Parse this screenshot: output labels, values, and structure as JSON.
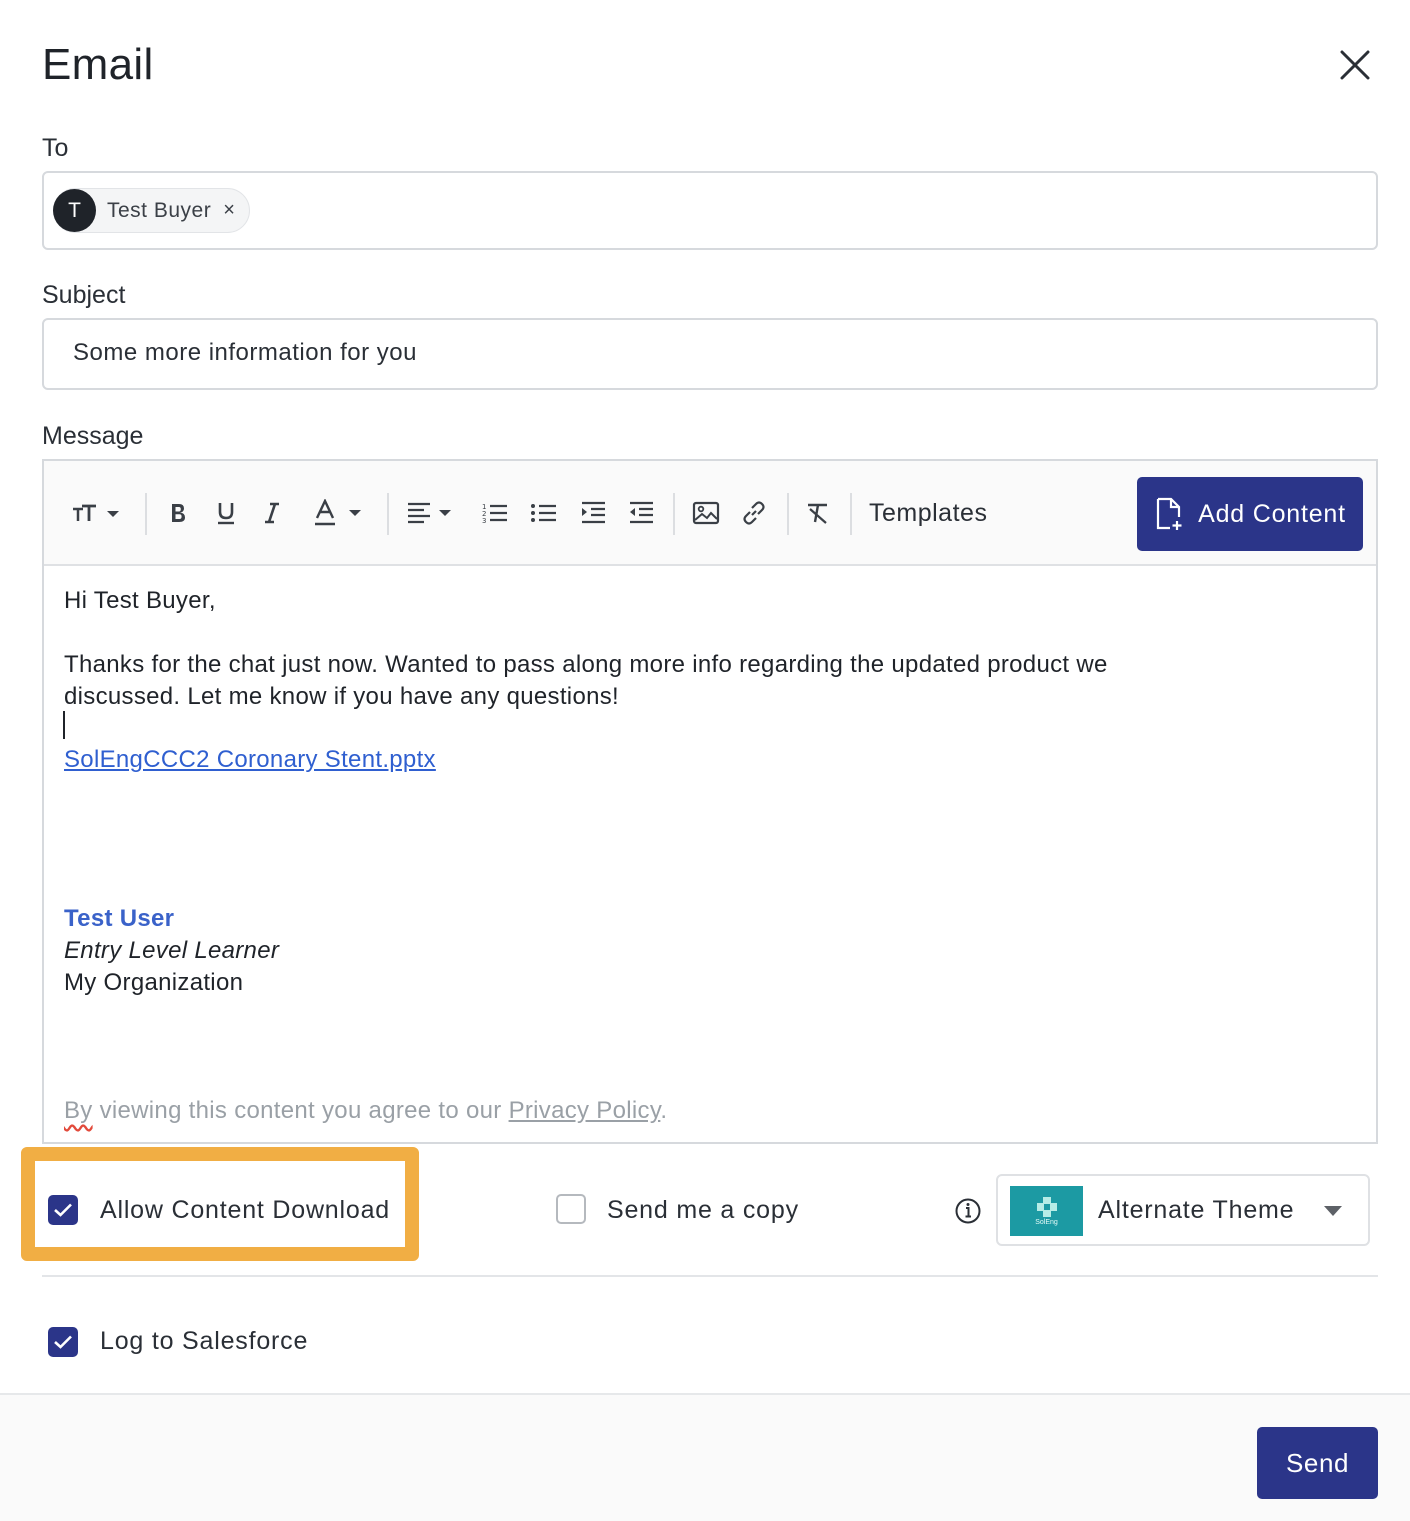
{
  "dialog": {
    "title": "Email",
    "close_icon": "close-icon"
  },
  "to": {
    "label": "To",
    "recipients": [
      {
        "initial": "T",
        "name": "Test Buyer",
        "remove_glyph": "×"
      }
    ]
  },
  "subject": {
    "label": "Subject",
    "value": "Some more information for you"
  },
  "message": {
    "label": "Message",
    "toolbar": {
      "templates_label": "Templates",
      "add_content_label": "Add Content",
      "icons": [
        "font-size-icon",
        "bold-icon",
        "underline-icon",
        "italic-icon",
        "text-color-icon",
        "align-icon",
        "ordered-list-icon",
        "bullet-list-icon",
        "indent-icon",
        "outdent-icon",
        "image-icon",
        "link-icon",
        "clear-format-icon",
        "add-file-icon"
      ]
    },
    "body": {
      "greeting": "Hi Test Buyer,",
      "line1": "Thanks for the chat just now. Wanted to pass along more info regarding the updated product we",
      "line2": "discussed. Let me know if you have any questions!",
      "attachment_link": "SolEngCCC2 Coronary Stent.pptx",
      "signature_name": "Test User",
      "signature_title": "Entry Level Learner",
      "signature_org": "My Organization",
      "privacy_by": "By",
      "privacy_mid": " viewing this content you agree to our ",
      "privacy_link": "Privacy Policy",
      "privacy_end": "."
    }
  },
  "options": {
    "allow_download": {
      "label": "Allow Content Download",
      "checked": true
    },
    "send_copy": {
      "label": "Send me a copy",
      "checked": false
    },
    "theme": {
      "label": "Alternate Theme",
      "thumb_text": "SolEng"
    },
    "log_salesforce": {
      "label": "Log to Salesforce",
      "checked": true
    }
  },
  "footer": {
    "send_label": "Send"
  },
  "colors": {
    "primary": "#2b3589",
    "link": "#2f5fd0",
    "highlight": "#f1ae44",
    "theme_thumb": "#1c9aa3"
  }
}
